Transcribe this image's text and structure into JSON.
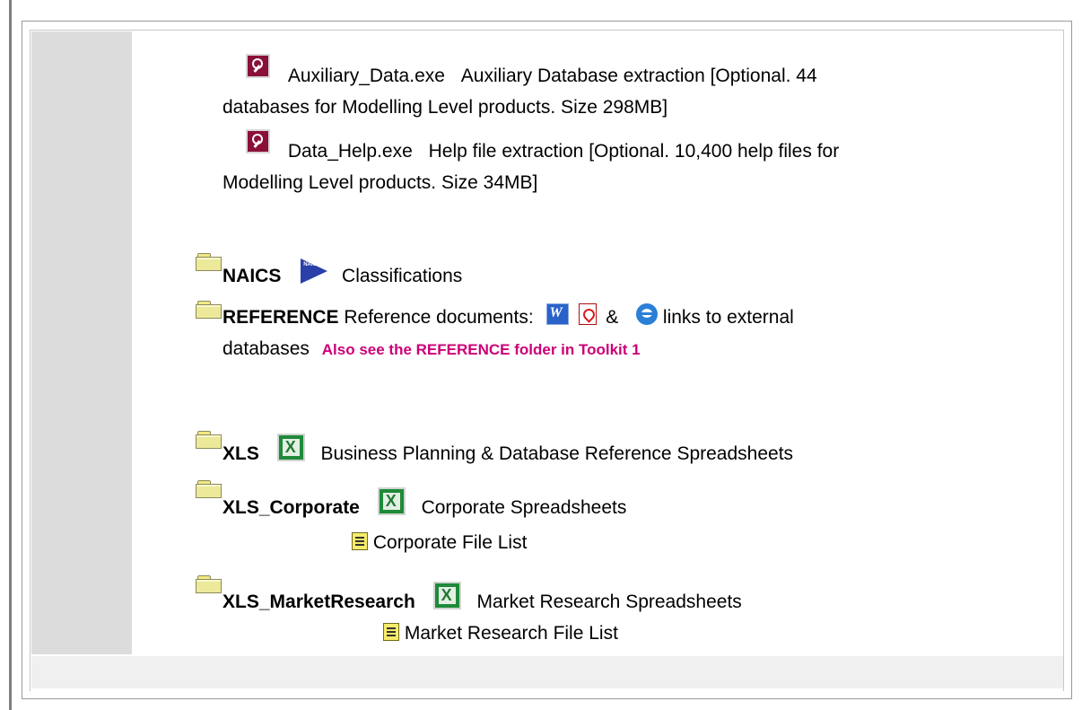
{
  "downloads": [
    {
      "filename": "Auxiliary_Data.exe",
      "description_line1": "Auxiliary Database extraction [Optional. 44",
      "description_line2": "databases for Modelling Level products. Size 298MB]"
    },
    {
      "filename": "Data_Help.exe",
      "description_line1": "Help file extraction [Optional. 10,400 help files for",
      "description_line2": "Modelling Level products. Size 34MB]"
    }
  ],
  "folders": {
    "naics": {
      "name": "NAICS",
      "description": "Classifications"
    },
    "reference": {
      "name": "REFERENCE",
      "description_part1": "Reference documents:",
      "ampersand": "&",
      "description_part2": "links to external",
      "description_line2": "databases",
      "note": "Also see the REFERENCE folder in Toolkit 1"
    },
    "xls": {
      "name": "XLS",
      "description": "Business Planning & Database Reference Spreadsheets"
    },
    "xls_corporate": {
      "name": "XLS_Corporate",
      "description": "Corporate Spreadsheets",
      "file_list": "Corporate File List"
    },
    "xls_marketresearch": {
      "name": "XLS_MarketResearch",
      "description": "Market Research Spreadsheets",
      "file_list": "Market Research File List"
    }
  },
  "icons": {
    "access": "access-key-icon",
    "folder": "folder-icon",
    "excel": "excel-icon",
    "word": "word-icon",
    "pdf": "pdf-icon",
    "ie": "internet-explorer-icon",
    "naics": "naics-logo-icon",
    "file_list": "document-list-icon"
  },
  "colors": {
    "note": "#cc0077",
    "gray_column": "#dcdcdc",
    "frame": "#9a9a9a"
  }
}
